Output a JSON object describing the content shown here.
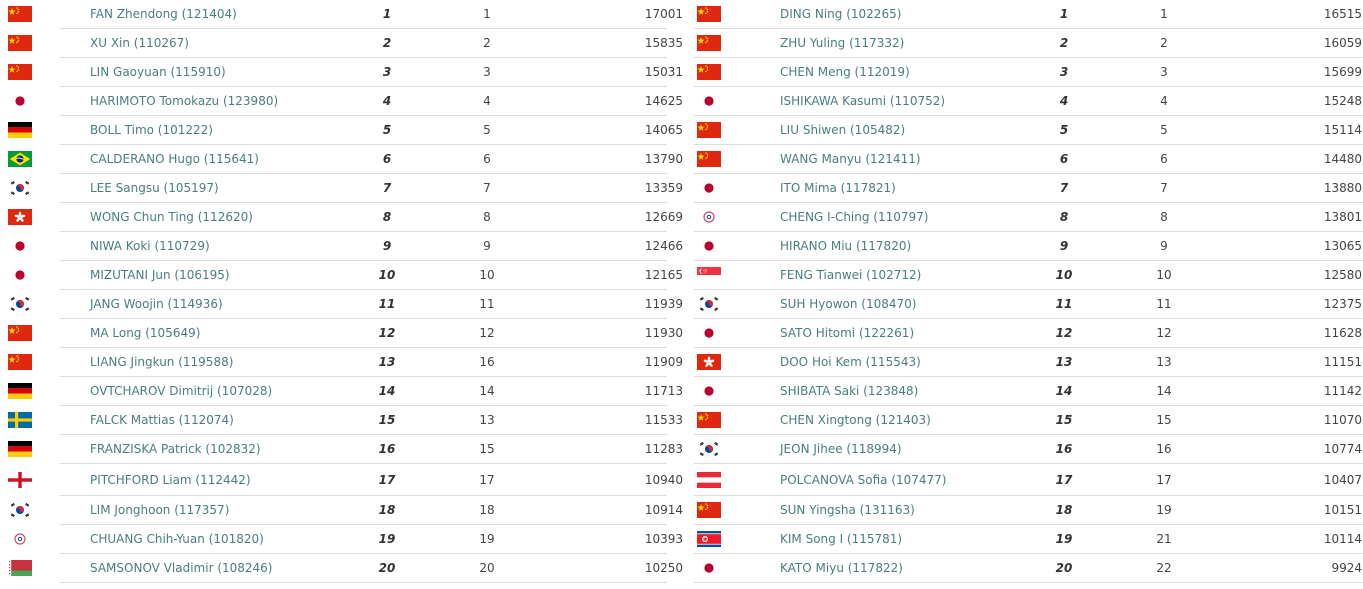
{
  "men": [
    {
      "flag": "china",
      "name": "FAN Zhendong (121404)",
      "rank": "1",
      "prev": "1",
      "points": "17001"
    },
    {
      "flag": "china",
      "name": "XU Xin (110267)",
      "rank": "2",
      "prev": "2",
      "points": "15835"
    },
    {
      "flag": "china",
      "name": "LIN Gaoyuan (115910)",
      "rank": "3",
      "prev": "3",
      "points": "15031"
    },
    {
      "flag": "japan",
      "name": "HARIMOTO Tomokazu (123980)",
      "rank": "4",
      "prev": "4",
      "points": "14625"
    },
    {
      "flag": "germany",
      "name": "BOLL Timo (101222)",
      "rank": "5",
      "prev": "5",
      "points": "14065"
    },
    {
      "flag": "brazil",
      "name": "CALDERANO Hugo (115641)",
      "rank": "6",
      "prev": "6",
      "points": "13790"
    },
    {
      "flag": "korea",
      "name": "LEE Sangsu (105197)",
      "rank": "7",
      "prev": "7",
      "points": "13359"
    },
    {
      "flag": "hongkong",
      "name": "WONG Chun Ting (112620)",
      "rank": "8",
      "prev": "8",
      "points": "12669"
    },
    {
      "flag": "japan",
      "name": "NIWA Koki (110729)",
      "rank": "9",
      "prev": "9",
      "points": "12466"
    },
    {
      "flag": "japan",
      "name": "MIZUTANI Jun (106195)",
      "rank": "10",
      "prev": "10",
      "points": "12165"
    },
    {
      "flag": "korea",
      "name": "JANG Woojin (114936)",
      "rank": "11",
      "prev": "11",
      "points": "11939"
    },
    {
      "flag": "china",
      "name": "MA Long (105649)",
      "rank": "12",
      "prev": "12",
      "points": "11930"
    },
    {
      "flag": "china",
      "name": "LIANG Jingkun (119588)",
      "rank": "13",
      "prev": "16",
      "points": "11909"
    },
    {
      "flag": "germany",
      "name": "OVTCHAROV Dimitrij (107028)",
      "rank": "14",
      "prev": "14",
      "points": "11713"
    },
    {
      "flag": "sweden",
      "name": "FALCK Mattias (112074)",
      "rank": "15",
      "prev": "13",
      "points": "11533"
    },
    {
      "flag": "germany",
      "name": "FRANZISKA Patrick (102832)",
      "rank": "16",
      "prev": "15",
      "points": "11283"
    },
    {
      "flag": "england",
      "name": "PITCHFORD Liam (112442)",
      "rank": "17",
      "prev": "17",
      "points": "10940"
    },
    {
      "flag": "korea",
      "name": "LIM Jonghoon (117357)",
      "rank": "18",
      "prev": "18",
      "points": "10914"
    },
    {
      "flag": "taipei",
      "name": "CHUANG Chih-Yuan (101820)",
      "rank": "19",
      "prev": "19",
      "points": "10393"
    },
    {
      "flag": "belarus",
      "name": "SAMSONOV Vladimir (108246)",
      "rank": "20",
      "prev": "20",
      "points": "10250"
    }
  ],
  "women": [
    {
      "flag": "china",
      "name": "DING Ning (102265)",
      "rank": "1",
      "prev": "1",
      "points": "16515"
    },
    {
      "flag": "china",
      "name": "ZHU Yuling (117332)",
      "rank": "2",
      "prev": "2",
      "points": "16059"
    },
    {
      "flag": "china",
      "name": "CHEN Meng (112019)",
      "rank": "3",
      "prev": "3",
      "points": "15699"
    },
    {
      "flag": "japan",
      "name": "ISHIKAWA Kasumi (110752)",
      "rank": "4",
      "prev": "4",
      "points": "15248"
    },
    {
      "flag": "china",
      "name": "LIU Shiwen (105482)",
      "rank": "5",
      "prev": "5",
      "points": "15114"
    },
    {
      "flag": "china",
      "name": "WANG Manyu (121411)",
      "rank": "6",
      "prev": "6",
      "points": "14480"
    },
    {
      "flag": "japan",
      "name": "ITO Mima (117821)",
      "rank": "7",
      "prev": "7",
      "points": "13880"
    },
    {
      "flag": "taipei",
      "name": "CHENG I-Ching (110797)",
      "rank": "8",
      "prev": "8",
      "points": "13801"
    },
    {
      "flag": "japan",
      "name": "HIRANO Miu (117820)",
      "rank": "9",
      "prev": "9",
      "points": "13065"
    },
    {
      "flag": "singapore",
      "name": "FENG Tianwei (102712)",
      "rank": "10",
      "prev": "10",
      "points": "12580"
    },
    {
      "flag": "korea",
      "name": "SUH Hyowon (108470)",
      "rank": "11",
      "prev": "11",
      "points": "12375"
    },
    {
      "flag": "japan",
      "name": "SATO Hitomi (122261)",
      "rank": "12",
      "prev": "12",
      "points": "11628"
    },
    {
      "flag": "hongkong",
      "name": "DOO Hoi Kem (115543)",
      "rank": "13",
      "prev": "13",
      "points": "11151"
    },
    {
      "flag": "japan",
      "name": "SHIBATA Saki (123848)",
      "rank": "14",
      "prev": "14",
      "points": "11142"
    },
    {
      "flag": "china",
      "name": "CHEN Xingtong (121403)",
      "rank": "15",
      "prev": "15",
      "points": "11070"
    },
    {
      "flag": "korea",
      "name": "JEON Jihee (118994)",
      "rank": "16",
      "prev": "16",
      "points": "10774"
    },
    {
      "flag": "austria",
      "name": "POLCANOVA Sofia (107477)",
      "rank": "17",
      "prev": "17",
      "points": "10407"
    },
    {
      "flag": "china",
      "name": "SUN Yingsha (131163)",
      "rank": "18",
      "prev": "19",
      "points": "10151"
    },
    {
      "flag": "northkorea",
      "name": "KIM Song I (115781)",
      "rank": "19",
      "prev": "21",
      "points": "10114"
    },
    {
      "flag": "japan",
      "name": "KATO Miyu (117822)",
      "rank": "20",
      "prev": "22",
      "points": "9924"
    }
  ],
  "colors": {
    "name_link": "#4a7e7e",
    "row_border": "#dcdcdc"
  }
}
